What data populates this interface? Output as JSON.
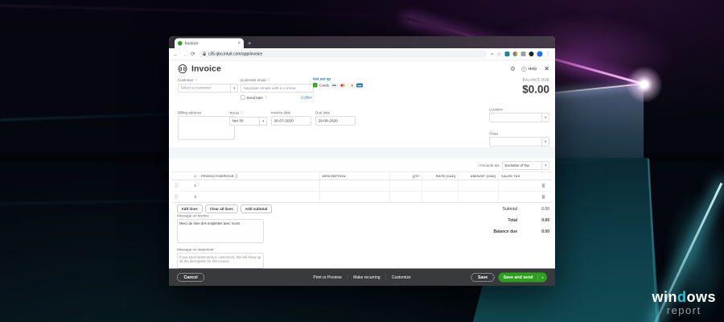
{
  "icons": {
    "back": "←",
    "forward": "→",
    "reload": "⟳",
    "search": "⌕",
    "star": "☆",
    "menu": "⋮",
    "close": "✕",
    "plus": "+",
    "gear": "⚙",
    "help_mark": "?",
    "info": "ⓘ",
    "dropdown": "▾",
    "check": "✓"
  },
  "browser": {
    "tab_title": "Invoice",
    "url": "c35.qbo.intuit.com/app/invoice"
  },
  "watermark": {
    "part1": "win",
    "accent": "d",
    "part2": "ows",
    "line2": "report"
  },
  "invoice": {
    "title": "Invoice",
    "help_label": "Help",
    "get_set_up": "Get set up",
    "cards_label": "Cards",
    "card_brands": [
      "visa",
      "mastercard",
      "discover",
      "amex"
    ],
    "balance_due_label": "BALANCE DUE",
    "balance_due_value": "$0.00",
    "customer": {
      "label": "Customer",
      "placeholder": "Select a customer"
    },
    "customer_email": {
      "label": "Customer email",
      "placeholder": "Separate emails with a comma"
    },
    "send_later_label": "Send later",
    "cc_bcc": "Cc/Bcc",
    "billing_address_label": "Billing address",
    "terms": {
      "label": "Terms",
      "value": "Net 30"
    },
    "invoice_date": {
      "label": "Invoice date",
      "value": "30-07-2020"
    },
    "due_date": {
      "label": "Due date",
      "value": "29-08-2020"
    },
    "location_label": "Location",
    "class_label": "Class",
    "amounts": {
      "label": "Amounts are",
      "value": "Exclusive of Tax"
    },
    "table": {
      "headers": {
        "num": "#",
        "product": "PRODUCT/SERVICE",
        "description": "DESCRIPTION",
        "qty": "QTY",
        "rate": "RATE (CAD)",
        "amount": "AMOUNT (CAD)",
        "tax": "SALES TAX"
      },
      "rows": [
        {
          "num": "1"
        },
        {
          "num": "2"
        }
      ]
    },
    "line_buttons": {
      "add_lines": "Add lines",
      "clear_all": "Clear all lines",
      "add_subtotal": "Add subtotal"
    },
    "totals": [
      {
        "label": "Subtotal",
        "value": "0.00"
      },
      {
        "label": "Total",
        "value": "0.00"
      },
      {
        "label": "Balance due",
        "value": "0.00"
      }
    ],
    "message_invoice": {
      "label": "Message on invoice",
      "value": "Merci de faire des emplettes avec nous!"
    },
    "message_statement": {
      "label": "Message on statement",
      "placeholder": "If you send statements to customers, this will show up as the description for this invoice."
    },
    "footer": {
      "cancel": "Cancel",
      "print_preview": "Print or Preview",
      "make_recurring": "Make recurring",
      "customize": "Customize",
      "save": "Save",
      "save_and_send": "Save and send"
    }
  },
  "colors": {
    "qb_green": "#2ca01c",
    "link_teal": "#0077c5",
    "footer_bar": "#393a3d",
    "wallpaper_magenta": "#c45fc4",
    "wallpaper_cyan": "#5fe3ef"
  }
}
